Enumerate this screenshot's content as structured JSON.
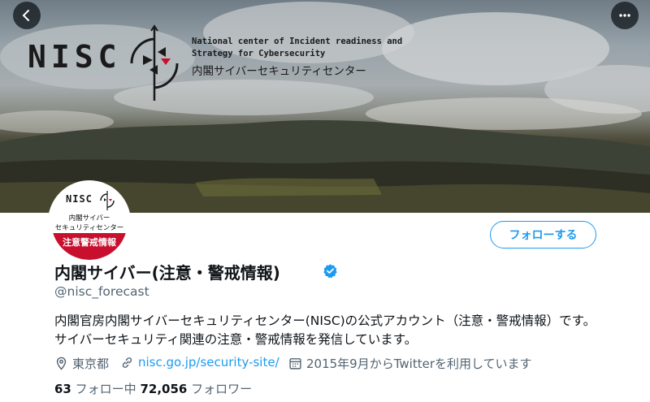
{
  "banner": {
    "logo_text": "NISC",
    "english_name": "National center of Incident readiness and\nStrategy for Cybersecurity",
    "japanese_name": "内閣サイバーセキュリティセンター"
  },
  "avatar": {
    "logo_text": "NISC",
    "line1": "内閣サイバー",
    "line2": "セキュリティセンター",
    "band_text": "注意警戒情報",
    "band_color": "#c8102e"
  },
  "actions": {
    "follow_label": "フォローする"
  },
  "profile": {
    "display_name": "内閣サイバー(注意・警戒情報)",
    "handle": "@nisc_forecast",
    "bio": "内閣官房内閣サイバーセキュリティセンター(NISC)の公式アカウント（注意・警戒情報）です。サイバーセキュリティ関連の注意・警戒情報を発信しています。",
    "location": "東京都",
    "website": "nisc.go.jp/security-site/",
    "joined": "2015年9月からTwitterを利用しています",
    "following_count": "63",
    "following_label": "フォロー中",
    "followers_count": "72,056",
    "followers_label": "フォロワー"
  },
  "icons": {
    "back": "arrow-left-icon",
    "more": "more-horizontal-icon",
    "verified": "verified-badge-icon",
    "location": "location-pin-icon",
    "link": "link-icon",
    "calendar": "calendar-icon"
  },
  "colors": {
    "accent": "#1d9bf0",
    "secondary_text": "#536471",
    "primary_text": "#0f1419"
  }
}
